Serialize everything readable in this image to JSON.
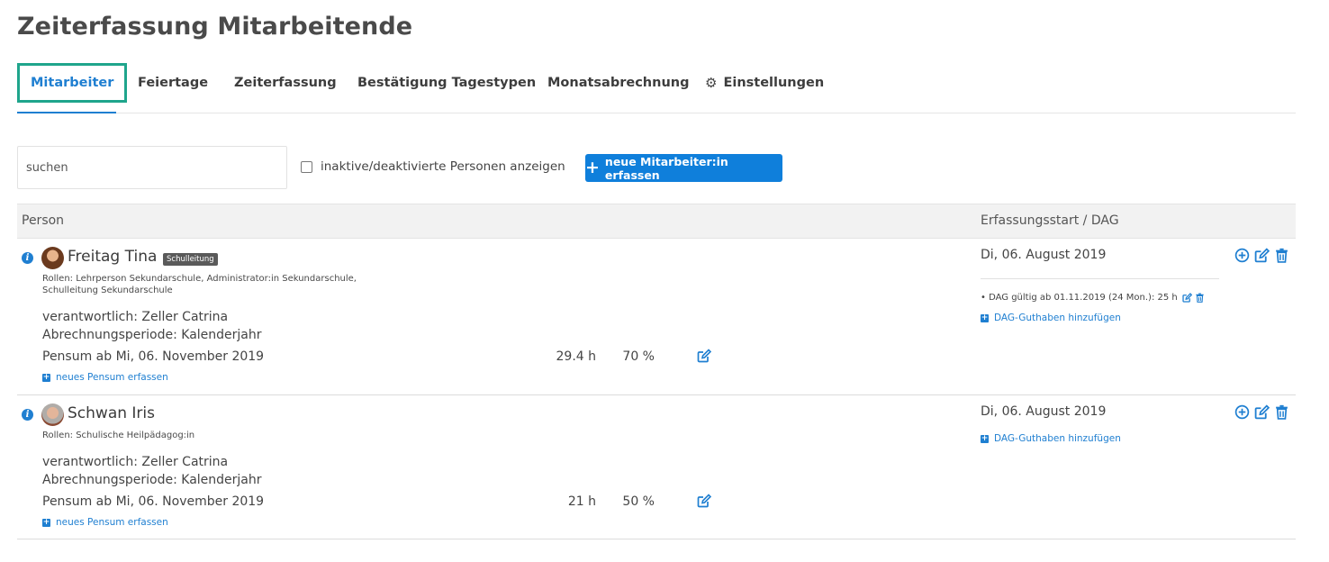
{
  "page": {
    "title": "Zeiterfassung Mitarbeitende"
  },
  "tabs": [
    {
      "label": "Mitarbeiter",
      "active": true
    },
    {
      "label": "Feiertage"
    },
    {
      "label": "Zeiterfassung"
    },
    {
      "label": "Bestätigung Tagestypen"
    },
    {
      "label": "Monatsabrechnung"
    },
    {
      "label": "Einstellungen",
      "icon": "gear-icon"
    }
  ],
  "toolbar": {
    "search_placeholder": "suchen",
    "inactive_label": "inaktive/deaktivierte Personen anzeigen",
    "new_button_label": "neue Mitarbeiter:in erfassen"
  },
  "table": {
    "col_person": "Person",
    "col_start": "Erfassungsstart / DAG",
    "rows": [
      {
        "name": "Freitag Tina",
        "badge": "Schulleitung",
        "roles_line1": "Rollen: Lehrperson Sekundarschule, Administrator:in Sekundarschule,",
        "roles_line2": "Schulleitung Sekundarschule",
        "responsible": "verantwortlich: Zeller Catrina",
        "period": "Abrechnungsperiode: Kalenderjahr",
        "pensum": "Pensum ab Mi, 06. November 2019",
        "hours": "29.4 h",
        "percent": "70 %",
        "add_pensum": "neues Pensum erfassen",
        "start_date": "Di, 06. August 2019",
        "dag_entry": "• DAG gültig ab 01.11.2019 (24 Mon.): 25 h",
        "dag_add": "DAG-Guthaben hinzufügen"
      },
      {
        "name": "Schwan Iris",
        "roles_line1": "Rollen: Schulische Heilpädagog:in",
        "responsible": "verantwortlich: Zeller Catrina",
        "period": "Abrechnungsperiode: Kalenderjahr",
        "pensum": "Pensum ab Mi, 06. November 2019",
        "hours": "21 h",
        "percent": "50 %",
        "add_pensum": "neues Pensum erfassen",
        "start_date": "Di, 06. August 2019",
        "dag_add": "DAG-Guthaben hinzufügen"
      }
    ]
  },
  "colors": {
    "accent": "#1f7fd1",
    "focus_border": "#1fa58c",
    "button": "#0f7fdb",
    "badge": "#5a5a5a"
  }
}
